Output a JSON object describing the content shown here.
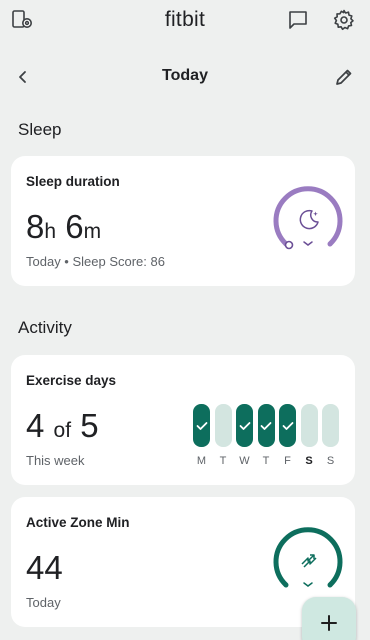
{
  "app": {
    "title": "fitbit"
  },
  "nav": {
    "title": "Today"
  },
  "sections": {
    "sleep": "Sleep",
    "activity": "Activity"
  },
  "sleep_card": {
    "title": "Sleep duration",
    "hours": "8",
    "hours_unit": "h",
    "minutes": "6",
    "minutes_unit": "m",
    "subtitle": "Today • Sleep Score: 86",
    "ring_color": "#9a7cc1",
    "ring_track": "#e6dcf0"
  },
  "exercise_card": {
    "title": "Exercise days",
    "value": "4",
    "of": "of",
    "goal": "5",
    "subtitle": "This week",
    "days": [
      {
        "label": "M",
        "done": true,
        "today": false
      },
      {
        "label": "T",
        "done": false,
        "today": false
      },
      {
        "label": "W",
        "done": true,
        "today": false
      },
      {
        "label": "T",
        "done": true,
        "today": false
      },
      {
        "label": "F",
        "done": true,
        "today": false
      },
      {
        "label": "S",
        "done": false,
        "today": true
      },
      {
        "label": "S",
        "done": false,
        "today": false
      }
    ],
    "done_color": "#0d6e5d",
    "empty_color": "#d3e5e0"
  },
  "azm_card": {
    "title": "Active Zone Min",
    "value": "44",
    "subtitle": "Today",
    "ring_color": "#0d6e5d"
  },
  "fab": {
    "label": "+"
  }
}
